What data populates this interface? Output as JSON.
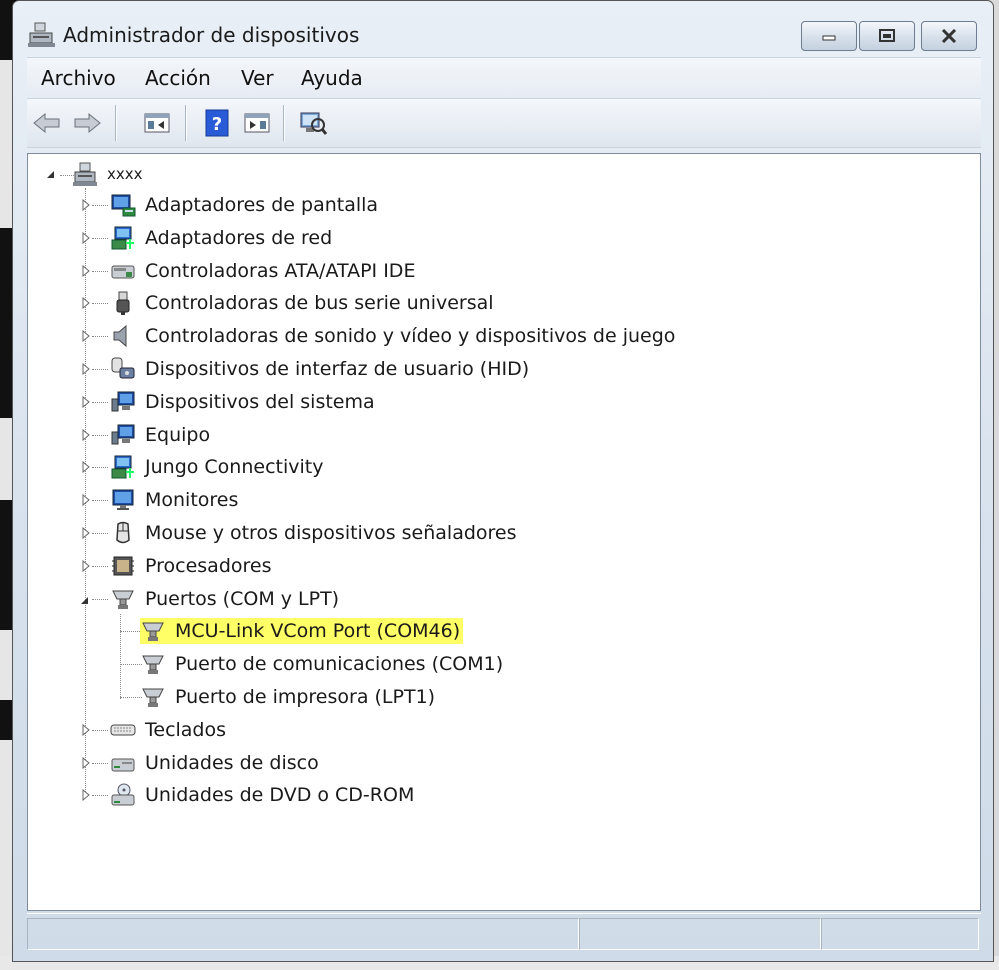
{
  "window": {
    "title": "Administrador de dispositivos",
    "controls": [
      "minimize",
      "maximize",
      "close"
    ]
  },
  "menu": [
    "Archivo",
    "Acción",
    "Ver",
    "Ayuda"
  ],
  "toolbar": [
    "back-arrow-icon",
    "forward-arrow-icon",
    "show-hide-console-tree-icon",
    "help-icon",
    "action-pane-icon",
    "scan-hardware-changes-icon"
  ],
  "tree": {
    "root": "xxxx",
    "categories": [
      {
        "label": "Adaptadores de pantalla",
        "icon": "display-adapter-icon"
      },
      {
        "label": "Adaptadores de red",
        "icon": "network-adapter-icon"
      },
      {
        "label": "Controladoras ATA/ATAPI IDE",
        "icon": "ide-controller-icon"
      },
      {
        "label": "Controladoras de bus serie universal",
        "icon": "usb-icon"
      },
      {
        "label": "Controladoras de sonido y vídeo y dispositivos de juego",
        "icon": "speaker-icon"
      },
      {
        "label": "Dispositivos de interfaz de usuario (HID)",
        "icon": "hid-icon"
      },
      {
        "label": "Dispositivos del sistema",
        "icon": "system-device-icon"
      },
      {
        "label": "Equipo",
        "icon": "computer-icon"
      },
      {
        "label": "Jungo Connectivity",
        "icon": "network-adapter-icon"
      },
      {
        "label": "Monitores",
        "icon": "monitor-icon"
      },
      {
        "label": "Mouse y otros dispositivos señaladores",
        "icon": "mouse-icon"
      },
      {
        "label": "Procesadores",
        "icon": "processor-icon"
      },
      {
        "label": "Puertos (COM y LPT)",
        "icon": "port-icon",
        "expanded": true
      },
      {
        "label": "Teclados",
        "icon": "keyboard-icon"
      },
      {
        "label": "Unidades de disco",
        "icon": "disk-drive-icon"
      },
      {
        "label": "Unidades de DVD o CD-ROM",
        "icon": "dvd-drive-icon"
      }
    ],
    "ports": [
      {
        "label": "MCU-Link VCom Port (COM46)",
        "highlighted": true
      },
      {
        "label": "Puerto de comunicaciones (COM1)",
        "highlighted": false
      },
      {
        "label": "Puerto de impresora (LPT1)",
        "highlighted": false
      }
    ]
  },
  "colors": {
    "highlight": "#ffff66",
    "window_frame": "#d6e1ed"
  }
}
